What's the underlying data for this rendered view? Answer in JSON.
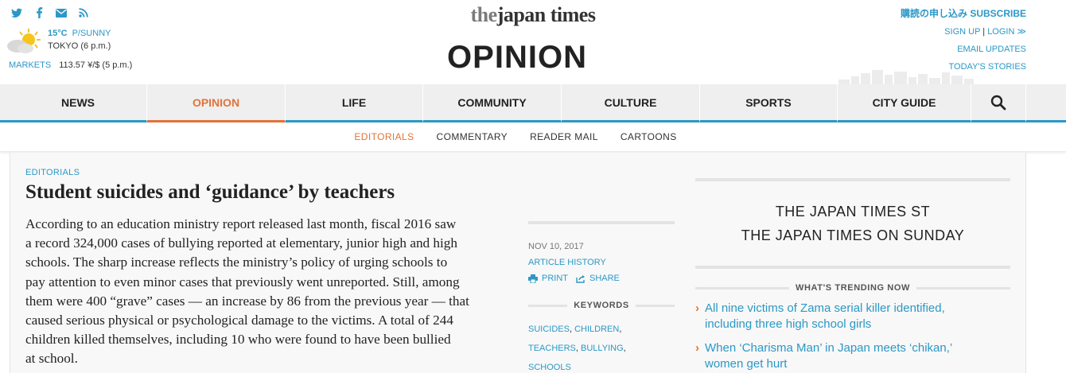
{
  "header": {
    "social_icons": [
      "twitter-icon",
      "facebook-icon",
      "mail-icon",
      "rss-icon"
    ],
    "weather": {
      "temperature": "15°C",
      "condition": "P/SUNNY",
      "location": "TOKYO (6 p.m.)",
      "icon": "partly-sunny-icon"
    },
    "markets": {
      "label": "MARKETS",
      "value": "113.57 ¥/$ (5 p.m.)"
    },
    "logo": {
      "the": "the",
      "name": "japan times"
    },
    "section_title": "OPINION",
    "subscribe": "購読の申し込み SUBSCRIBE",
    "signup": "SIGN UP",
    "login": "LOGIN ≫",
    "email_updates": "EMAIL UPDATES",
    "todays_stories": "TODAY'S STORIES"
  },
  "nav": {
    "items": [
      "NEWS",
      "OPINION",
      "LIFE",
      "COMMUNITY",
      "CULTURE",
      "SPORTS",
      "CITY GUIDE"
    ],
    "active": "OPINION",
    "search_icon": "search-icon"
  },
  "subnav": {
    "items": [
      "EDITORIALS",
      "COMMENTARY",
      "READER MAIL",
      "CARTOONS"
    ],
    "active": "EDITORIALS"
  },
  "article": {
    "kicker": "EDITORIALS",
    "headline": "Student suicides and ‘guidance’ by teachers",
    "lines": [
      "According to an education ministry report released last month, fiscal 2016 saw",
      "a record 324,000 cases of bullying reported at elementary, junior high and high",
      "schools. The sharp increase reflects the ministry’s policy of urging schools to",
      "pay attention to even minor cases that previously went unreported. Still, among",
      "them were 400 “grave” cases — an increase by 86 from the previous year — that",
      "caused serious physical or psychological damage to the victims. A total of 244",
      "children killed themselves, including 10 who were found to have been bullied",
      "at school."
    ]
  },
  "meta": {
    "date": "NOV 10, 2017",
    "history": "ARTICLE HISTORY",
    "print": "PRINT",
    "share": "SHARE",
    "keywords_heading": "KEYWORDS",
    "keywords": [
      "SUICIDES",
      "CHILDREN",
      "TEACHERS",
      "BULLYING",
      "SCHOOLS"
    ]
  },
  "sidebar": {
    "promo_line1": "THE JAPAN TIMES ST",
    "promo_line2": "THE JAPAN TIMES ON SUNDAY",
    "trending_heading": "WHAT'S TRENDING NOW",
    "trending": [
      {
        "line1": "All nine victims of Zama serial killer identified,",
        "line2": "including three high school girls"
      },
      {
        "line1": "When ‘Charisma Man’ in Japan meets ‘chikan,’",
        "line2": "women get hurt"
      }
    ]
  },
  "colors": {
    "accent_blue": "#2b98c6",
    "accent_orange": "#e2733a",
    "nav_bg": "#efefef"
  }
}
